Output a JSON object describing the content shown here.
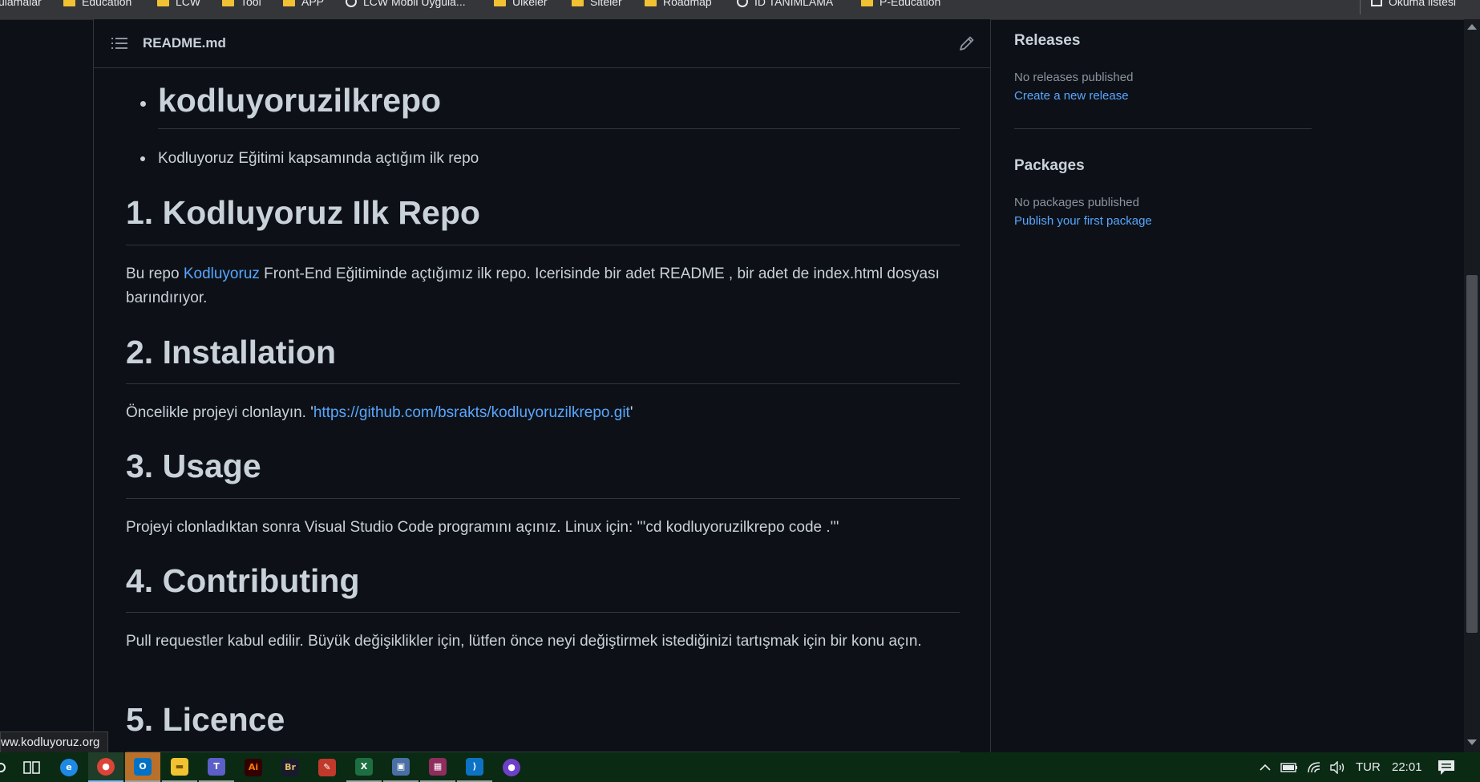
{
  "bookmarks": {
    "items": [
      {
        "label": "ulamalar",
        "icon": "none"
      },
      {
        "label": "Education",
        "icon": "folder-icon"
      },
      {
        "label": "LCW",
        "icon": "folder-icon"
      },
      {
        "label": "Tool",
        "icon": "folder-icon"
      },
      {
        "label": "APP",
        "icon": "folder-icon"
      },
      {
        "label": "LCW Mobil Uygula...",
        "icon": "globe-icon"
      },
      {
        "label": "Ülkeler",
        "icon": "folder-icon"
      },
      {
        "label": "Siteler",
        "icon": "folder-icon"
      },
      {
        "label": "Roadmap",
        "icon": "folder-icon"
      },
      {
        "label": "ID TANIMLAMA",
        "icon": "globe-icon"
      },
      {
        "label": "P-Education",
        "icon": "folder-icon"
      }
    ],
    "reading_list": "Okuma listesi"
  },
  "readme": {
    "title": "README.md",
    "bullet_heading": "kodluyoruzilkrepo",
    "bullet_text": "Kodluyoruz Eğitimi kapsamında açtığım ilk repo",
    "sections": {
      "s1": {
        "heading": "1. Kodluyoruz Ilk Repo",
        "text_before": "Bu repo ",
        "link": "Kodluyoruz",
        "text_after": " Front-End Eğitiminde açtığımız ilk repo. Icerisinde bir adet README , bir adet de index.html dosyası barındırıyor."
      },
      "s2": {
        "heading": "2. Installation",
        "text_before": "Öncelikle projeyi clonlayın. '",
        "link": "https://github.com/bsrakts/kodluyoruzilkrepo.git",
        "text_after": "'"
      },
      "s3": {
        "heading": "3. Usage",
        "text": "Projeyi clonladıktan sonra Visual Studio Code programını açınız. Linux için: '''cd kodluyoruzilkrepo code .'''"
      },
      "s4": {
        "heading": "4. Contributing",
        "text": "Pull requestler kabul edilir. Büyük değişiklikler için, lütfen önce neyi değiştirmek istediğinizi tartışmak için bir konu açın."
      },
      "s5": {
        "heading": "5. Licence"
      }
    }
  },
  "sidebar": {
    "releases": {
      "heading": "Releases",
      "status": "No releases published",
      "link": "Create a new release"
    },
    "packages": {
      "heading": "Packages",
      "status": "No packages published",
      "link": "Publish your first package"
    }
  },
  "status_url": "ww.kodluyoruz.org",
  "taskbar": {
    "apps": [
      {
        "name": "edge",
        "label": "e",
        "color": "#1e88e5"
      },
      {
        "name": "chrome",
        "label": "●",
        "color": "#db4437"
      },
      {
        "name": "outlook",
        "label": "O",
        "color": "#0072c6"
      },
      {
        "name": "file-explorer",
        "label": "▬",
        "color": "#f1c232"
      },
      {
        "name": "teams",
        "label": "T",
        "color": "#5b5fc7"
      },
      {
        "name": "illustrator",
        "label": "Ai",
        "color": "#330000"
      },
      {
        "name": "bridge",
        "label": "Br",
        "color": "#1a1a2e"
      },
      {
        "name": "paint",
        "label": "✎",
        "color": "#c0392b"
      },
      {
        "name": "excel",
        "label": "X",
        "color": "#1d6f42"
      },
      {
        "name": "screen-tool",
        "label": "▣",
        "color": "#4a6fa5"
      },
      {
        "name": "winrar",
        "label": "▦",
        "color": "#8e2d5e"
      },
      {
        "name": "vscode",
        "label": "⟩",
        "color": "#0e72c4"
      },
      {
        "name": "github-desktop",
        "label": "●",
        "color": "#6e40c9"
      }
    ],
    "language": "TUR",
    "time": "22:01"
  }
}
